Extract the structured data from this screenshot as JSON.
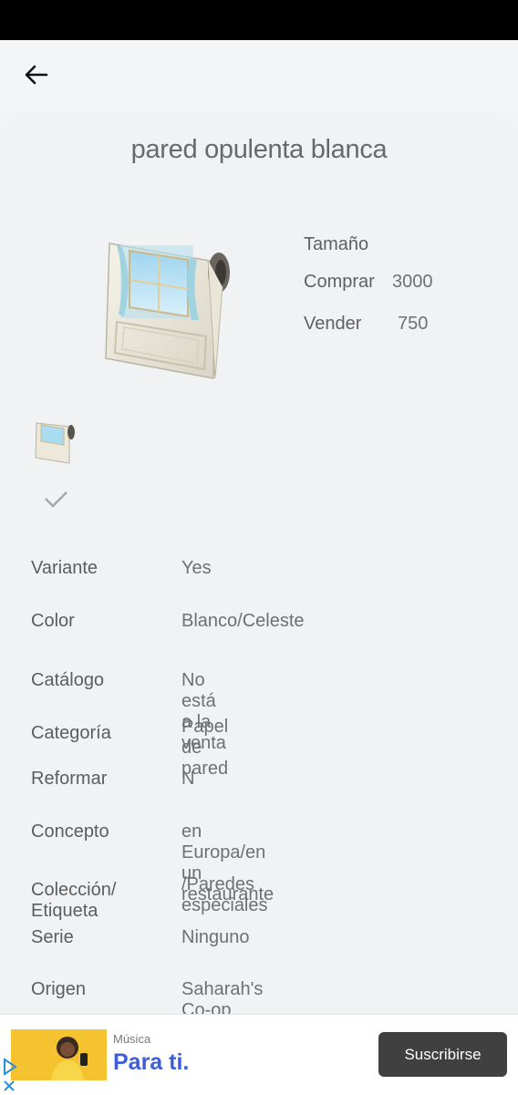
{
  "header": {
    "back_icon": "arrow-left-icon"
  },
  "item": {
    "title": "pared opulenta blanca",
    "size_label": "Tamaño",
    "buy_label": "Comprar",
    "buy_price": "3000",
    "sell_label": "Vender",
    "sell_price": "750"
  },
  "variant_selector": {
    "selected_icon": "checkmark-icon"
  },
  "details": [
    {
      "label": "Variante",
      "value": "Yes"
    },
    {
      "label": "Color",
      "value": "Blanco/Celeste"
    },
    {
      "label": "Catálogo",
      "value": "No está a la venta"
    },
    {
      "label": "Categoría",
      "value": "Papel de pared"
    },
    {
      "label": "Reformar",
      "value": "N"
    },
    {
      "label": "Concepto",
      "value": "en Europa/en un restaurante"
    },
    {
      "label": "Colección/\nEtiqueta",
      "value": "/Paredes especiales"
    },
    {
      "label": "Serie",
      "value": "Ninguno"
    },
    {
      "label": "Origen",
      "value": "Saharah's Co-op"
    }
  ],
  "ad": {
    "small_text": "Música",
    "big_text": "Para ti.",
    "button_label": "Suscribirse",
    "play_icon": "ad-choices-icon",
    "close_icon": "close-icon"
  },
  "colors": {
    "background": "#f2f3f5",
    "ad_button": "#404040",
    "ad_headline": "#3d5ed8",
    "ad_image": "#f5c230"
  }
}
